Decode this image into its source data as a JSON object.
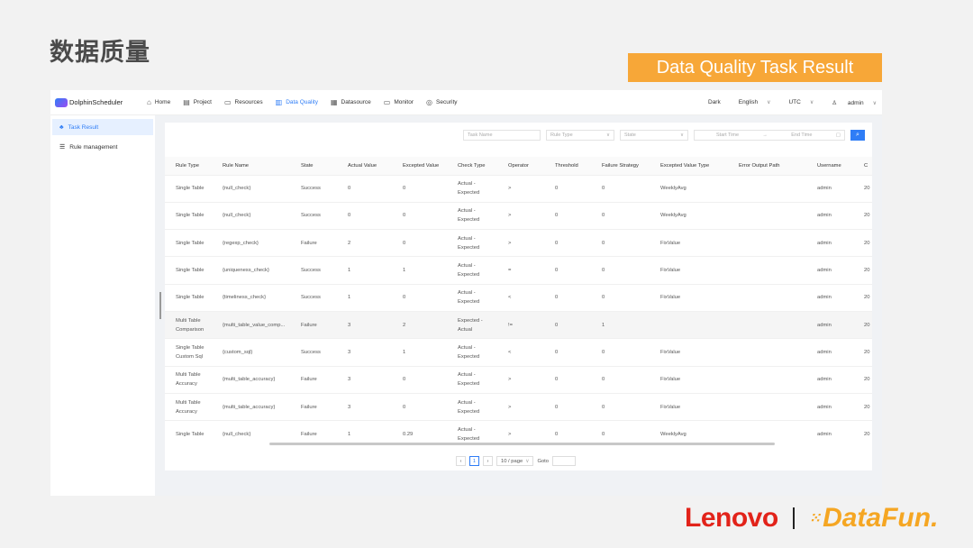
{
  "slide": {
    "title": "数据质量",
    "badge": "Data Quality Task Result"
  },
  "app": {
    "brand": "DolphinScheduler",
    "nav": [
      {
        "label": "Home",
        "icon": "home-icon"
      },
      {
        "label": "Project",
        "icon": "project-icon"
      },
      {
        "label": "Resources",
        "icon": "folder-icon"
      },
      {
        "label": "Data Quality",
        "icon": "data-quality-icon",
        "active": true
      },
      {
        "label": "Datasource",
        "icon": "datasource-icon"
      },
      {
        "label": "Monitor",
        "icon": "monitor-icon"
      },
      {
        "label": "Security",
        "icon": "security-icon"
      }
    ],
    "right": {
      "theme": "Dark",
      "language": "English",
      "timezone": "UTC",
      "user": "admin"
    }
  },
  "sidebar": {
    "items": [
      {
        "label": "Task Result",
        "icon": "task-result-icon",
        "active": true
      },
      {
        "label": "Rule management",
        "icon": "list-icon",
        "active": false
      }
    ]
  },
  "filters": {
    "task_name": "Task Name",
    "rule_type": "Rule Type",
    "state": "State",
    "start_time": "Start Time",
    "end_time": "End Time"
  },
  "table": {
    "headers": [
      "Rule Type",
      "Rule Name",
      "State",
      "Actual Value",
      "Excepted Value",
      "Check Type",
      "Operator",
      "Threshold",
      "Failure Strategy",
      "Excepted Value Type",
      "Error Output Path",
      "Username",
      "C"
    ],
    "rows": [
      [
        "Single Table",
        "{null_check}",
        "Success",
        "0",
        "0",
        "Actual - Expected",
        ">",
        "0",
        "0",
        "WeeklyAvg",
        "",
        "admin",
        "20"
      ],
      [
        "Single Table",
        "{null_check}",
        "Success",
        "0",
        "0",
        "Actual - Expected",
        ">",
        "0",
        "0",
        "WeeklyAvg",
        "",
        "admin",
        "20"
      ],
      [
        "Single Table",
        "{regexp_check}",
        "Failure",
        "2",
        "0",
        "Actual - Expected",
        ">",
        "0",
        "0",
        "FixValue",
        "",
        "admin",
        "20"
      ],
      [
        "Single Table",
        "{uniqueness_check}",
        "Success",
        "1",
        "1",
        "Actual - Expected",
        "=",
        "0",
        "0",
        "FixValue",
        "",
        "admin",
        "20"
      ],
      [
        "Single Table",
        "{timeliness_check}",
        "Success",
        "1",
        "0",
        "Actual - Expected",
        "<",
        "0",
        "0",
        "FixValue",
        "",
        "admin",
        "20"
      ],
      [
        "Multi Table Comparison",
        "{multi_table_value_comp...",
        "Failure",
        "3",
        "2",
        "Expected - Actual",
        "!=",
        "0",
        "1",
        "",
        "",
        "admin",
        "20"
      ],
      [
        "Single Table Custom Sql",
        "{custom_sql}",
        "Success",
        "3",
        "1",
        "Actual - Expected",
        "<",
        "0",
        "0",
        "FixValue",
        "",
        "admin",
        "20"
      ],
      [
        "Multi Table Accuracy",
        "{multi_table_accuracy}",
        "Failure",
        "3",
        "0",
        "Actual - Expected",
        ">",
        "0",
        "0",
        "FixValue",
        "",
        "admin",
        "20"
      ],
      [
        "Multi Table Accuracy",
        "{multi_table_accuracy}",
        "Failure",
        "3",
        "0",
        "Actual - Expected",
        ">",
        "0",
        "0",
        "FixValue",
        "",
        "admin",
        "20"
      ],
      [
        "Single Table",
        "{null_check}",
        "Failure",
        "1",
        "0.29",
        "Actual - Expected",
        ">",
        "0",
        "0",
        "WeeklyAvg",
        "",
        "admin",
        "20"
      ]
    ]
  },
  "pagination": {
    "current": "1",
    "page_size": "10 / page",
    "goto_label": "Goto"
  },
  "footer": {
    "lenovo": "Lenovo",
    "datafun": "DataFun."
  }
}
